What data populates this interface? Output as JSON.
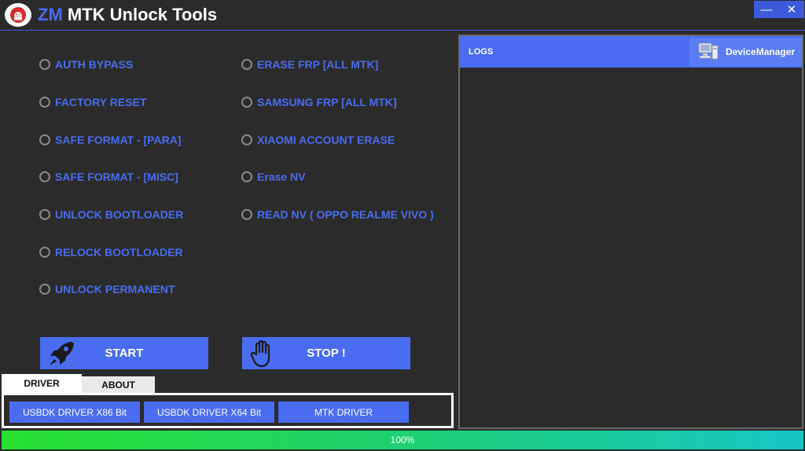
{
  "window": {
    "brand": "ZM",
    "title": "MTK Unlock Tools",
    "minimize_glyph": "—",
    "close_glyph": "✕",
    "logo_icon": "android-icon"
  },
  "options_left": [
    "AUTH BYPASS",
    "FACTORY RESET",
    "SAFE FORMAT - [PARA]",
    "SAFE FORMAT - [MISC]",
    "UNLOCK BOOTLOADER",
    "RELOCK BOOTLOADER",
    "UNLOCK PERMANENT"
  ],
  "options_right": [
    "ERASE FRP [ALL MTK]",
    "SAMSUNG FRP [ALL MTK]",
    "XIAOMI ACCOUNT ERASE",
    "Erase NV",
    "READ NV ( OPPO REALME VIVO )"
  ],
  "actions": {
    "start_label": "START",
    "start_icon": "rocket-icon",
    "stop_label": "STOP !",
    "stop_icon": "hand-icon"
  },
  "tabs": {
    "driver": "DRIVER",
    "about": "ABOUT",
    "active": "DRIVER"
  },
  "drivers": {
    "x86": "USBDK DRIVER X86 Bit",
    "x64": "USBDK DRIVER X64 Bit",
    "mtk": "MTK DRIVER"
  },
  "logs": {
    "label": "LOGS",
    "device_manager": "DeviceManager",
    "device_manager_icon": "computer-icon"
  },
  "progress": {
    "value": 1.0,
    "text": "100%"
  },
  "colors": {
    "accent": "#4a6cf0",
    "background": "#2b2b2b"
  }
}
